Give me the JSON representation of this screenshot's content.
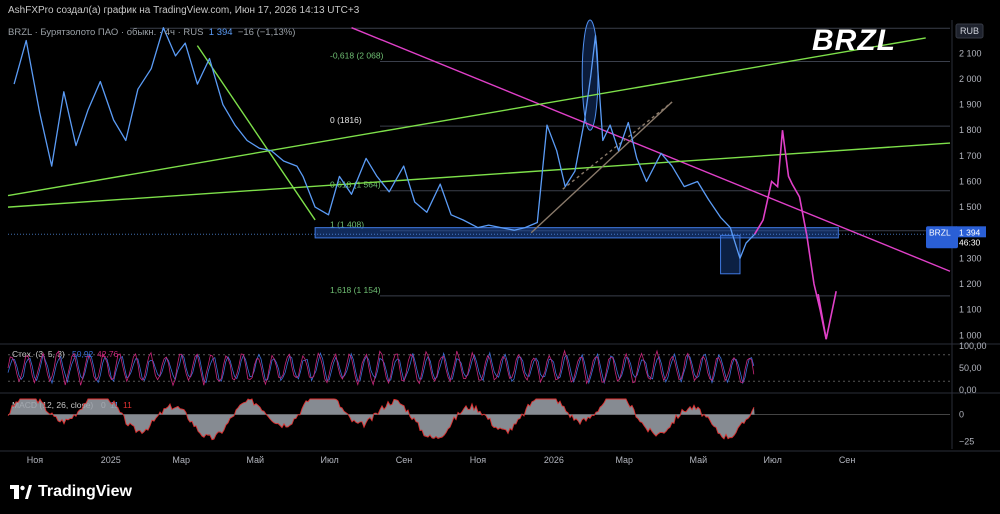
{
  "header": {
    "author_line": "AshFXPro создал(а) график на TradingView.com, Июн 17, 2026 14:13 UTC+3"
  },
  "symbol_line": {
    "name": "BRZL · Бурятзолото ПАО · обыкн. · 4ч · RUS",
    "price": "1 394",
    "change": "−16 (−1,13%)"
  },
  "watermark": "BRZL",
  "brand": "TradingView",
  "currency": "RUB",
  "price_tag": {
    "symbol": "BRZL",
    "price": "1 394",
    "countdown": "46:30",
    "value": 1394
  },
  "colors": {
    "price": "#5b9cf6",
    "trend_magenta": "#e040c8",
    "trend_green": "#7ee04a",
    "level": "#3a3f4b",
    "zone_fill": "#1f4fa8",
    "stoch_k": "#c8267a",
    "stoch_d": "#3b6fd8",
    "macd_hist": "#9ea3ab",
    "macd_line": "#e03030"
  },
  "chart_data": [
    {
      "type": "line",
      "panel": "price",
      "y_axis_ticks": [
        1000,
        1100,
        1200,
        1300,
        1400,
        1500,
        1600,
        1700,
        1800,
        1900,
        2000,
        2100
      ],
      "y_axis_labels": [
        "1 000",
        "1 100",
        "1 200",
        "1 300",
        "1 400",
        "1 500",
        "1 600",
        "1 700",
        "1 800",
        "1 900",
        "2 000",
        "2 100"
      ],
      "ylim": [
        970,
        2230
      ],
      "x_axis_labels": [
        "Ноя",
        "2025",
        "Мар",
        "Май",
        "Июл",
        "Сен",
        "Ноя",
        "2026",
        "Мар",
        "Май",
        "Июл",
        "Сен"
      ],
      "x_axis_dates": [
        "2024-11-01",
        "2025-01-01",
        "2025-03-01",
        "2025-05-01",
        "2025-07-01",
        "2025-09-01",
        "2025-11-01",
        "2026-01-01",
        "2026-03-01",
        "2026-05-01",
        "2026-07-01",
        "2026-09-01"
      ],
      "xlim": [
        "2024-10-10",
        "2026-11-25"
      ],
      "series": [
        {
          "x": [
            "2024-10-15",
            "2024-10-25",
            "2024-11-05",
            "2024-11-15",
            "2024-11-25",
            "2024-12-05",
            "2024-12-15",
            "2024-12-25",
            "2025-01-05",
            "2025-01-15",
            "2025-01-25",
            "2025-02-05",
            "2025-02-15",
            "2025-02-25",
            "2025-03-05",
            "2025-03-15",
            "2025-03-25",
            "2025-04-05",
            "2025-04-15",
            "2025-04-25",
            "2025-05-05",
            "2025-05-15",
            "2025-05-25",
            "2025-06-05",
            "2025-06-10",
            "2025-06-20",
            "2025-07-01",
            "2025-07-10",
            "2025-07-20",
            "2025-08-01",
            "2025-08-10",
            "2025-08-20",
            "2025-09-01",
            "2025-09-10",
            "2025-09-20",
            "2025-10-01",
            "2025-10-10",
            "2025-10-20",
            "2025-11-01",
            "2025-11-10",
            "2025-11-20",
            "2025-12-01",
            "2025-12-10",
            "2025-12-20",
            "2025-12-28",
            "2026-01-05",
            "2026-01-12",
            "2026-01-20",
            "2026-01-28",
            "2026-02-02",
            "2026-02-06",
            "2026-02-12",
            "2026-02-18",
            "2026-02-25",
            "2026-03-05",
            "2026-03-12",
            "2026-03-20",
            "2026-04-01",
            "2026-04-10",
            "2026-04-20",
            "2026-05-01",
            "2026-05-10",
            "2026-05-20",
            "2026-05-28",
            "2026-06-05",
            "2026-06-10",
            "2026-06-17"
          ],
          "values": [
            1980,
            2150,
            1870,
            1660,
            1950,
            1740,
            1880,
            1990,
            1840,
            1760,
            1960,
            2040,
            2200,
            2090,
            2140,
            1980,
            2080,
            1900,
            1820,
            1760,
            1730,
            1720,
            1680,
            1660,
            1620,
            1500,
            1470,
            1620,
            1550,
            1690,
            1620,
            1560,
            1660,
            1520,
            1480,
            1590,
            1470,
            1450,
            1420,
            1430,
            1420,
            1410,
            1420,
            1440,
            1820,
            1720,
            1580,
            1640,
            1840,
            2010,
            2170,
            1760,
            1820,
            1720,
            1830,
            1690,
            1600,
            1710,
            1660,
            1580,
            1600,
            1530,
            1460,
            1420,
            1300,
            1360,
            1394
          ]
        }
      ],
      "fib_levels": [
        {
          "label": "-0,618 (2 068)",
          "value": 2068
        },
        {
          "label": "0 (1816)",
          "value": 1816
        },
        {
          "label": "0,618 (1 564)",
          "value": 1564
        },
        {
          "label": "1 (1 408)",
          "value": 1408
        },
        {
          "label": "1,618 (1 154)",
          "value": 1154
        }
      ],
      "support_zone": {
        "x": [
          "2025-06-20",
          "2026-08-25"
        ],
        "y": [
          1380,
          1420
        ]
      },
      "highlight_box": {
        "x": [
          "2026-05-20",
          "2026-06-05"
        ],
        "y": [
          1240,
          1390
        ]
      },
      "ellipse": {
        "x": [
          "2026-01-26",
          "2026-02-08"
        ],
        "y": [
          1800,
          2230
        ]
      },
      "trendlines": [
        {
          "name": "magenta_down",
          "x": [
            "2025-07-20",
            "2026-11-25"
          ],
          "y": [
            2200,
            1250
          ]
        },
        {
          "name": "green_up",
          "x": [
            "2024-10-10",
            "2026-11-05"
          ],
          "y": [
            1545,
            2160
          ]
        },
        {
          "name": "green_flat",
          "x": [
            "2024-10-10",
            "2026-11-25"
          ],
          "y": [
            1500,
            1750
          ]
        },
        {
          "name": "green_down",
          "x": [
            "2025-03-15",
            "2025-06-20"
          ],
          "y": [
            2130,
            1450
          ]
        },
        {
          "name": "wedge_upper",
          "x": [
            "2025-12-15",
            "2026-04-10"
          ],
          "y": [
            1400,
            1910
          ]
        },
        {
          "name": "wedge_lower",
          "x": [
            "2026-01-10",
            "2026-04-10"
          ],
          "y": [
            1570,
            1910
          ]
        }
      ],
      "projection": {
        "x": [
          "2026-06-17",
          "2026-06-24",
          "2026-07-01",
          "2026-07-06",
          "2026-07-10",
          "2026-07-15",
          "2026-07-18",
          "2026-07-24",
          "2026-07-30",
          "2026-08-05",
          "2026-08-10",
          "2026-08-15"
        ],
        "values": [
          1394,
          1450,
          1600,
          1580,
          1800,
          1620,
          1590,
          1540,
          1390,
          1200,
          1100,
          985
        ]
      }
    },
    {
      "type": "line",
      "panel": "stochastic",
      "title": "Стох. (3, 5, 3)",
      "values_shown": {
        "k": "50,92",
        "d": "42,76"
      },
      "y_axis_labels": [
        "100,00",
        "50,00",
        "0,00"
      ],
      "y_axis_ticks": [
        100,
        50,
        0
      ],
      "ylim": [
        0,
        100
      ]
    },
    {
      "type": "bar",
      "panel": "macd",
      "title": "MACD (12, 26, close)",
      "values_shown": [
        "0",
        "11",
        "11"
      ],
      "y_axis_labels": [
        "0",
        "−25"
      ],
      "y_axis_ticks": [
        0,
        -25
      ],
      "ylim": [
        -32,
        18
      ]
    }
  ]
}
